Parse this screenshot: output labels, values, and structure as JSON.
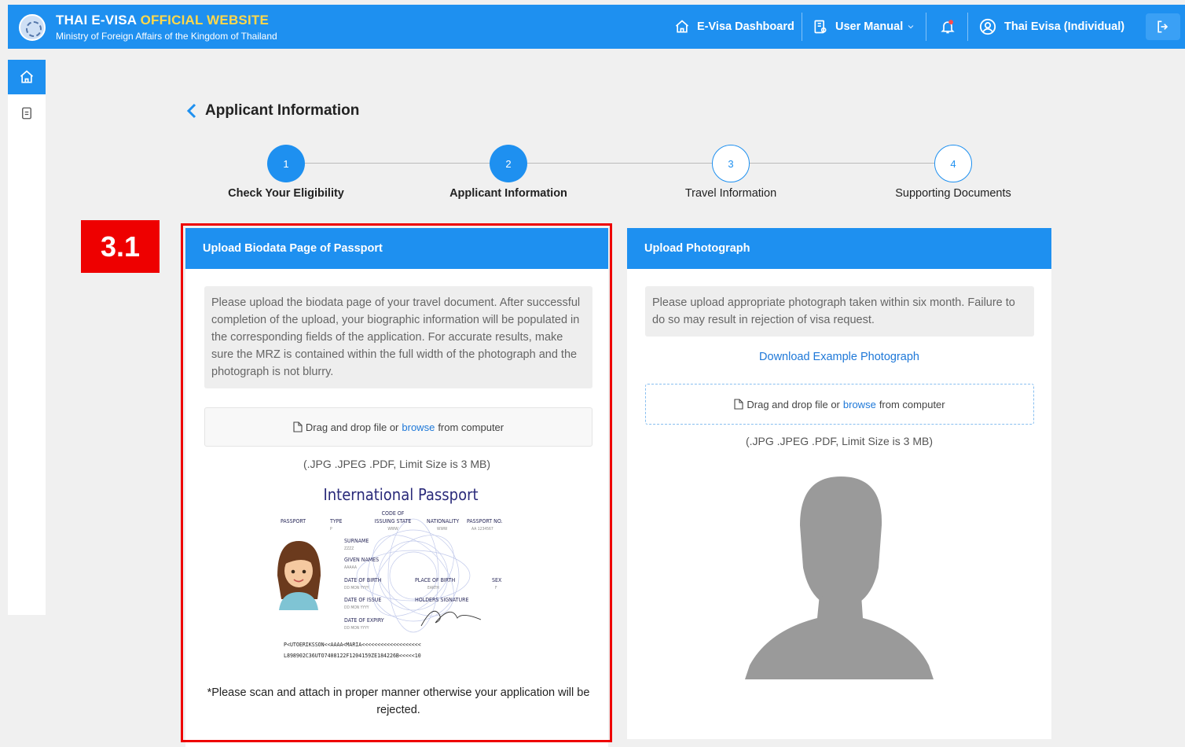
{
  "header": {
    "title_white": "THAI E-VISA",
    "title_yellow": "OFFICIAL WEBSITE",
    "subtitle": "Ministry of Foreign Affairs of the Kingdom of Thailand",
    "dashboard_label": "E-Visa Dashboard",
    "manual_label": "User Manual",
    "user_label": "Thai Evisa (Individual)"
  },
  "page": {
    "title": "Applicant Information",
    "annotation_tag": "3.1"
  },
  "steps": [
    {
      "num": "1",
      "label": "Check Your Eligibility",
      "state": "done"
    },
    {
      "num": "2",
      "label": "Applicant Information",
      "state": "done"
    },
    {
      "num": "3",
      "label": "Travel Information",
      "state": "todo"
    },
    {
      "num": "4",
      "label": "Supporting Documents",
      "state": "todo"
    }
  ],
  "passport_card": {
    "header": "Upload Biodata Page of Passport",
    "note": "Please upload the biodata page of your travel document. After successful completion of the upload, your biographic information will be populated in the corresponding fields of the application. For accurate results, make sure the MRZ is contained within the full width of the photograph and the photograph is not blurry.",
    "drop_text_pre": "Drag and drop file or",
    "drop_link": "browse",
    "drop_text_post": "from computer",
    "formats": "(.JPG .JPEG .PDF, Limit Size is 3 MB)",
    "warning": "*Please scan and attach in proper manner otherwise your application will be rejected."
  },
  "sample_passport": {
    "title": "International Passport",
    "passport": "PASSPORT",
    "type": "TYPE",
    "type_val": "P",
    "code1": "CODE OF",
    "code2": "ISSUING STATE",
    "code_val": "WWW",
    "nationality": "NATIONALITY",
    "nationality_val": "WWW",
    "passport_no": "PASSPORT NO.",
    "passport_no_val": "AA 1234567",
    "surname": "SURNAME",
    "surname_val": "ZZZZ",
    "given": "GIVEN NAMES",
    "given_val": "AAAAA",
    "dob": "DATE OF BIRTH",
    "dob_val": "DD MON YYYY",
    "pob": "PLACE OF BIRTH",
    "pob_val": "EARTH",
    "sex": "SEX",
    "sex_val": "F",
    "doi": "DATE OF ISSUE",
    "doi_val": "DD MON YYYY",
    "sig": "HOLDERS SIGNATURE",
    "doe": "DATE OF EXPIRY",
    "doe_val": "DD MON YYYY",
    "mrz1": "P<UTOERIKSSON<<AAAA<MARIA<<<<<<<<<<<<<<<<<<<",
    "mrz2": "L898902C36UTO7408122F1204159ZE184226B<<<<<10"
  },
  "photo_card": {
    "header": "Upload Photograph",
    "note": "Please upload appropriate photograph taken within six month. Failure to do so may result in rejection of visa request.",
    "download_link": "Download Example Photograph",
    "drop_text_pre": "Drag and drop file or",
    "drop_link": "browse",
    "drop_text_post": "from computer",
    "formats": "(.JPG .JPEG .PDF, Limit Size is 3 MB)"
  },
  "colors": {
    "primary": "#1e90f0",
    "accent_yellow": "#ffd84a",
    "annotation_red": "#ee0000",
    "link": "#1e78d8"
  },
  "icons": [
    "home-icon",
    "document-icon",
    "bell-icon",
    "user-circle-icon",
    "logout-icon",
    "chevron-left-icon",
    "file-icon",
    "manual-icon"
  ]
}
